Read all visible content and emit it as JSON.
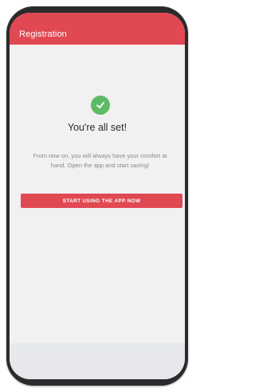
{
  "header": {
    "title": "Registration"
  },
  "confirmation": {
    "icon": "check-circle-icon",
    "headline": "You're all set!",
    "message": "From now on, you will always have your comfort at hand. Open the app and start saving!"
  },
  "actions": {
    "cta_label": "START USING THE APP NOW"
  },
  "colors": {
    "accent": "#e04852",
    "success": "#5dbb66",
    "screen_background": "#f2f0f1",
    "phone_frame": "#2b2b2d"
  }
}
